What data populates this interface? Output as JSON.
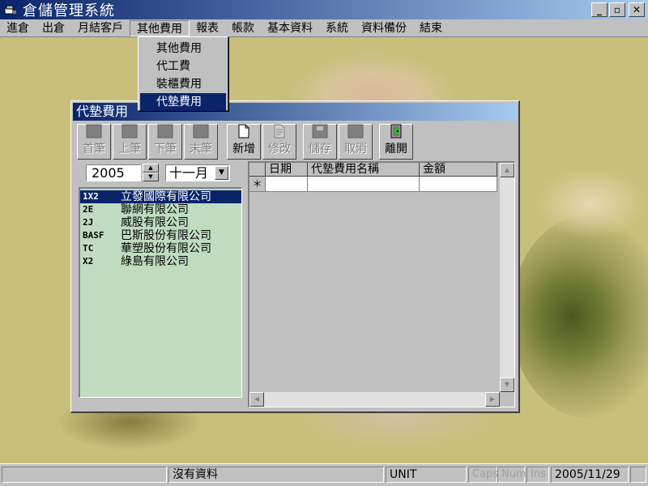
{
  "window": {
    "title": "倉儲管理系統",
    "minimize_label": "_",
    "restore_label": "▫",
    "close_label": "✕"
  },
  "menubar": {
    "items": [
      {
        "label": "進倉"
      },
      {
        "label": "出倉"
      },
      {
        "label": "月結客戶"
      },
      {
        "label": "其他費用"
      },
      {
        "label": "報表"
      },
      {
        "label": "帳款"
      },
      {
        "label": "基本資料"
      },
      {
        "label": "系統"
      },
      {
        "label": "資料備份"
      },
      {
        "label": "結束"
      }
    ]
  },
  "dropdown": {
    "items": [
      {
        "label": "其他費用"
      },
      {
        "label": "代工費"
      },
      {
        "label": "裝櫃費用"
      },
      {
        "label": "代墊費用"
      }
    ]
  },
  "child_window": {
    "title": "代墊費用",
    "toolbar": [
      {
        "label": "首筆"
      },
      {
        "label": "上筆"
      },
      {
        "label": "下筆"
      },
      {
        "label": "末筆"
      },
      {
        "label": "新增"
      },
      {
        "label": "修改"
      },
      {
        "label": "儲存"
      },
      {
        "label": "取消"
      },
      {
        "label": "離開"
      }
    ],
    "year": "2005",
    "month": "十一月",
    "customers": [
      {
        "code": "1X2",
        "name": "立發國際有限公司"
      },
      {
        "code": "2E",
        "name": "聯網有限公司"
      },
      {
        "code": "2J",
        "name": "威股有限公司"
      },
      {
        "code": "BASF",
        "name": "巴斯股份有限公司"
      },
      {
        "code": "TC",
        "name": "華塑股份有限公司"
      },
      {
        "code": "X2",
        "name": "綠島有限公司"
      }
    ],
    "grid": {
      "columns": [
        "日期",
        "代墊費用名稱",
        "金額"
      ],
      "new_row_marker": "＊"
    }
  },
  "statusbar": {
    "message": "沒有資料",
    "unit": "UNIT",
    "caps": "Caps",
    "num": "Num",
    "ins": "Ins",
    "date": "2005/11/29"
  },
  "colors": {
    "titlebar": "#0a246a",
    "desktop": "#c8bf7a",
    "list_bg": "#c0dcc0",
    "selection": "#0a246a"
  }
}
